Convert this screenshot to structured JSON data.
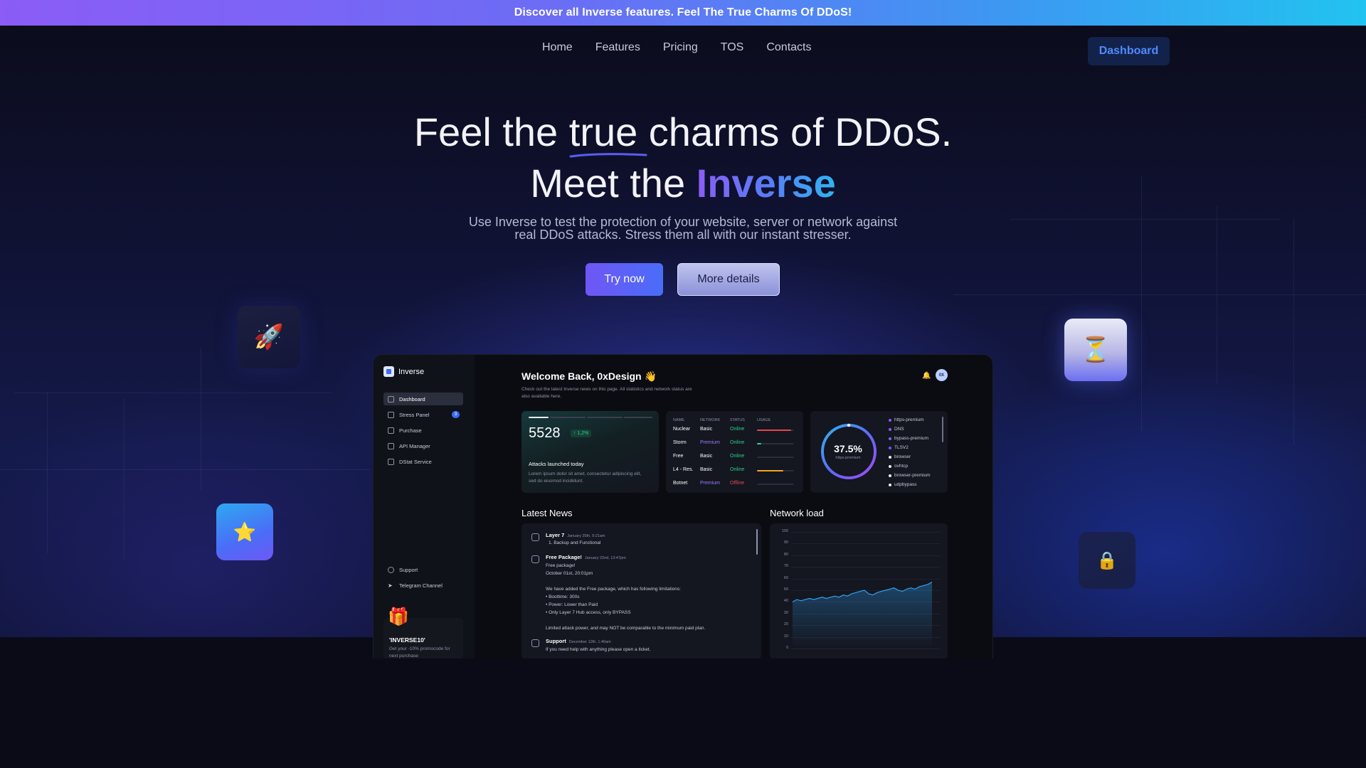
{
  "promo_bar": {
    "text": "Discover all Inverse features. Feel The True Charms Of DDoS!"
  },
  "nav": {
    "links": [
      "Home",
      "Features",
      "Pricing",
      "TOS",
      "Contacts"
    ],
    "dashboard_label": "Dashboard"
  },
  "hero": {
    "title_part1": "Feel the ",
    "title_underlined": "true",
    "title_part2": " charms of DDoS.",
    "title_line2_prefix": "Meet the ",
    "title_line2_brand": "Inverse",
    "subtitle_line1": "Use Inverse to test the protection of your website, server or network against",
    "subtitle_line2": "real DDoS attacks. Stress them all with our instant stresser.",
    "try_label": "Try now",
    "more_label": "More details"
  },
  "floating_icons": {
    "rocket": "🚀",
    "hourglass": "⏳",
    "star": "⭐",
    "lock": "🔒"
  },
  "dashboard": {
    "brand": "Inverse",
    "sidebar": [
      {
        "label": "Dashboard",
        "icon": "home-icon",
        "active": true
      },
      {
        "label": "Stress Panel",
        "icon": "wifi-icon",
        "badge": "3"
      },
      {
        "label": "Purchase",
        "icon": "cart-icon"
      },
      {
        "label": "API Manager",
        "icon": "api-icon"
      },
      {
        "label": "DStat Service",
        "icon": "chart-icon"
      }
    ],
    "sidebar_bottom": [
      {
        "label": "Support",
        "icon": "help-icon"
      },
      {
        "label": "Telegram Channel",
        "icon": "send-icon"
      }
    ],
    "promo": {
      "code": "'INVERSE10'",
      "desc": "Get your -10% promocode for next purchase",
      "gift": "🎁"
    },
    "welcome": "Welcome Back, 0xDesign 👋",
    "welcome_sub": "Check out the latest Inverse news on this page. All statistics and network status are also available here.",
    "avatar": "0X",
    "stat": {
      "value": "5528",
      "change": "↑ 1,2%",
      "label": "Attacks launched today",
      "desc": "Lorem ipsum dolor sit amet, consectetur adipiscing elit, sed do eiusmod incididunt."
    },
    "table": {
      "headers": [
        "NAME",
        "NETWORK",
        "STATUS",
        "USAGE"
      ],
      "rows": [
        {
          "name": "Nuclear",
          "network": "Basic",
          "status": "Online",
          "usage": 0.92,
          "color": "#e6494f"
        },
        {
          "name": "Storm",
          "network": "Premium",
          "status": "Online",
          "usage": 0.12,
          "color": "#2bd489"
        },
        {
          "name": "Free",
          "network": "Basic",
          "status": "Online",
          "usage": 0.0,
          "color": "#2bd489"
        },
        {
          "name": "L4 - Res.",
          "network": "Basic",
          "status": "Online",
          "usage": 0.72,
          "color": "#f5a524"
        },
        {
          "name": "Botnet",
          "network": "Premium",
          "status": "Offline",
          "usage": 0.0,
          "color": "#e6494f"
        }
      ]
    },
    "donut": {
      "value": "37.5%",
      "label": "https-premium",
      "fraction": 0.375,
      "legend": [
        {
          "label": "https-premium",
          "color": "#8b5cf6"
        },
        {
          "label": "DNS",
          "color": "#8b5cf6"
        },
        {
          "label": "bypass-premium",
          "color": "#8b5cf6"
        },
        {
          "label": "TLSV2",
          "color": "#6f56f5"
        },
        {
          "label": "browser",
          "color": "#e8ecf5"
        },
        {
          "label": "ovhtcp",
          "color": "#e8ecf5"
        },
        {
          "label": "browser-premium",
          "color": "#e8ecf5"
        },
        {
          "label": "udpbypass",
          "color": "#e8ecf5"
        }
      ]
    },
    "news_title": "Latest News",
    "news": [
      {
        "title": "Layer 7",
        "date": "January 25th, 9:21am",
        "body": "1. Backup and Functional"
      },
      {
        "title": "Free Package!",
        "date": "January 22nd, 13:47pm",
        "body": "Free package!\nOctober 01st, 20:01pm\n\nWe have added the Free package, which has following limitations:\n• Boottime: 300s\n• Power: Lower than Paid\n• Only Layer 7 Hub access, only BYPASS\n\nLimited attack power, and may NOT be comparable to the minimum paid plan."
      },
      {
        "title": "Support",
        "date": "December 12th, 1:40am",
        "body": "If you need help with anything please open a ticket."
      }
    ],
    "load_title": "Network load"
  },
  "chart_data": {
    "type": "area",
    "title": "Network load",
    "ylim": [
      0,
      100
    ],
    "yticks": [
      0,
      10,
      20,
      30,
      40,
      50,
      60,
      70,
      80,
      90,
      100
    ],
    "values": [
      40,
      42,
      41,
      42,
      43,
      42,
      43,
      44,
      43,
      44,
      45,
      44,
      46,
      45,
      47,
      48,
      49,
      50,
      47,
      46,
      48,
      49,
      50,
      51,
      52,
      50,
      49,
      51,
      52,
      51,
      53,
      54,
      55,
      57
    ],
    "color": "#2fa0f0"
  }
}
